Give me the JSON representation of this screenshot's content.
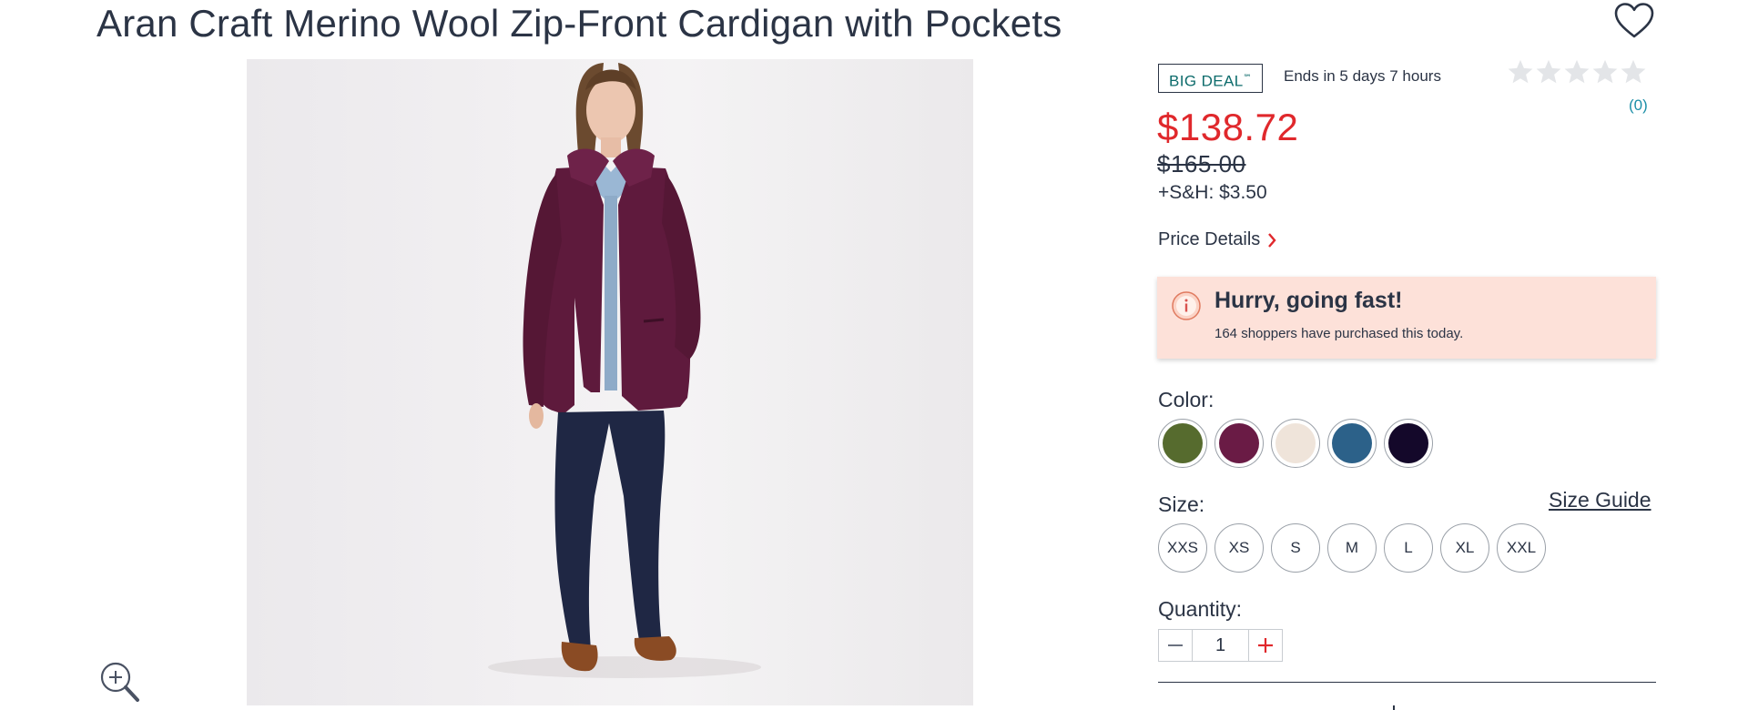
{
  "product": {
    "title": "Aran Craft Merino Wool Zip-Front Cardigan with Pockets",
    "image_alt": "Model wearing plum zip-front cable knit cardigan over denim shirt and jeans"
  },
  "icons": {
    "wishlist": "heart-outline-icon",
    "zoom": "zoom-in-icon",
    "info": "info-circle-icon",
    "chevron": "chevron-right-icon",
    "star": "star-icon"
  },
  "deal": {
    "badge": "BIG DEAL",
    "badge_mark": "℠",
    "ends_text": "Ends in 5 days 7 hours"
  },
  "rating": {
    "stars_filled": 0,
    "stars_total": 5,
    "count_text": "(0)"
  },
  "pricing": {
    "price": "$138.72",
    "original_price": "$165.00",
    "shipping": "+S&H: $3.50",
    "details_link": "Price Details"
  },
  "alert": {
    "title": "Hurry, going fast!",
    "text": "164 shoppers have purchased this today."
  },
  "color": {
    "label": "Color:",
    "options": [
      {
        "name": "olive",
        "hex": "#566b2e"
      },
      {
        "name": "plum",
        "hex": "#6a1b45"
      },
      {
        "name": "cream",
        "hex": "#efe4da"
      },
      {
        "name": "blue",
        "hex": "#2c6189"
      },
      {
        "name": "navy",
        "hex": "#14082a"
      }
    ]
  },
  "size": {
    "label": "Size:",
    "guide_link": "Size Guide",
    "options": [
      "XXS",
      "XS",
      "S",
      "M",
      "L",
      "XL",
      "XXL"
    ]
  },
  "quantity": {
    "label": "Quantity:",
    "value": "1"
  },
  "colors": {
    "text": "#2b3445",
    "sale": "#e0282c",
    "accent_teal": "#0c6b6b",
    "link_blue": "#1c8fa8",
    "alert_bg": "#fde1d9"
  }
}
